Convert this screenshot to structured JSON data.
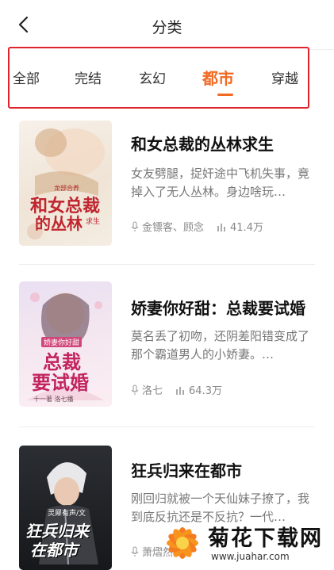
{
  "header": {
    "title": "分类"
  },
  "tabs": [
    {
      "label": "全部"
    },
    {
      "label": "完结"
    },
    {
      "label": "玄幻"
    },
    {
      "label": "都市",
      "active": true
    },
    {
      "label": "穿越"
    }
  ],
  "accent_color": "#f26a22",
  "highlight_box_color": "#e0242b",
  "books": [
    {
      "title": "和女总裁的丛林求生",
      "desc": "女友劈腿，捉奸途中飞机失事，竟掉入了无人丛林。身边啥玩…",
      "authors": "金镖客、顾念",
      "plays": "41.4万",
      "cover": {
        "big1": "和女总裁",
        "big2": "的丛林",
        "tag": "求生",
        "badge": "龙部合养"
      }
    },
    {
      "title": "娇妻你好甜：总裁要试婚",
      "desc": "莫名丢了初吻，还阴差阳错变成了那个霸道男人的小娇妻。…",
      "authors": "洛七",
      "plays": "64.3万",
      "cover": {
        "big1": "总裁",
        "big2": "要试婚",
        "tag": "娇妻你好甜",
        "credit": "十一著  洛七播"
      }
    },
    {
      "title": "狂兵归来在都市",
      "desc": "刚回归就被一个天仙妹子撩了，我到底反抗还是不反抗？一代…",
      "authors": "萧熠然",
      "plays": "",
      "cover": {
        "big1": "狂兵归来",
        "big2": "在都市",
        "tag": "灵犀有声/文"
      }
    }
  ],
  "watermark": {
    "text": "菊花下载网",
    "url": "www.juahar.com"
  }
}
